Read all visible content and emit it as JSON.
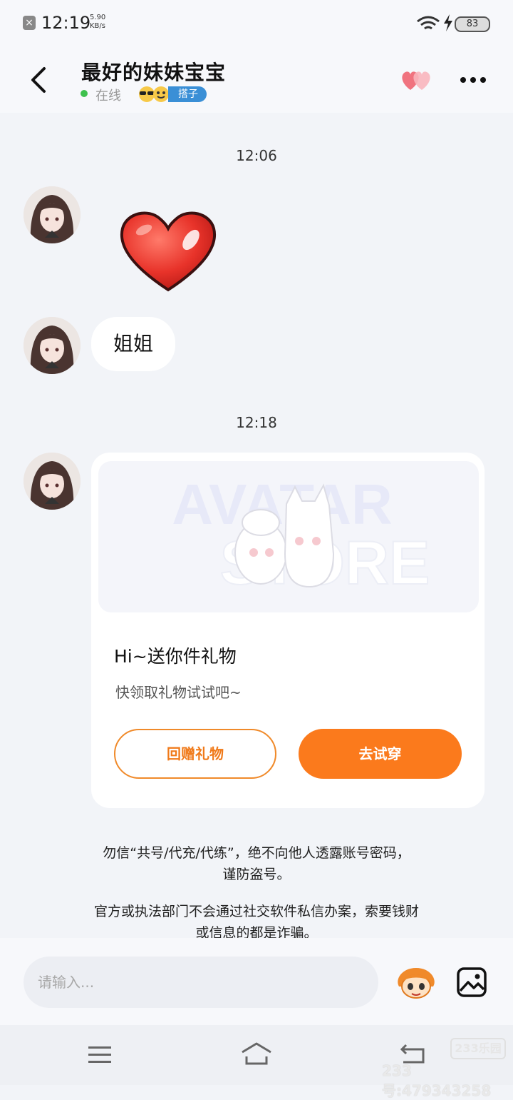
{
  "status_bar": {
    "time": "12:19",
    "speed_value": "5.90",
    "speed_unit": "KB/s",
    "battery": "83"
  },
  "header": {
    "title": "最好的妹妹宝宝",
    "online_text": "在线",
    "tag": "搭子"
  },
  "chat": {
    "timestamp_1": "12:06",
    "text_message": "姐姐",
    "timestamp_2": "12:18",
    "gift_card": {
      "watermark_line1": "AVATAR",
      "watermark_line2": "STORE",
      "title": "Hi~送你件礼物",
      "subtitle": "快领取礼物试试吧~",
      "return_button": "回赠礼物",
      "try_button": "去试穿"
    },
    "notice_1_line1": "勿信“共号/代充/代练”，绝不向他人透露账号密码，",
    "notice_1_line2": "谨防盗号。",
    "notice_2_line1": "官方或执法部门不会通过社交软件私信办案，索要钱财",
    "notice_2_line2": "或信息的都是诈骗。"
  },
  "input_bar": {
    "placeholder": "请输入..."
  },
  "watermark": {
    "logo": "233乐园",
    "user_id": "233号:479343258"
  },
  "colors": {
    "accent": "#fb7a1c",
    "online": "#3ec14d",
    "tag": "#3a8fd6",
    "background": "#f2f4f8"
  }
}
